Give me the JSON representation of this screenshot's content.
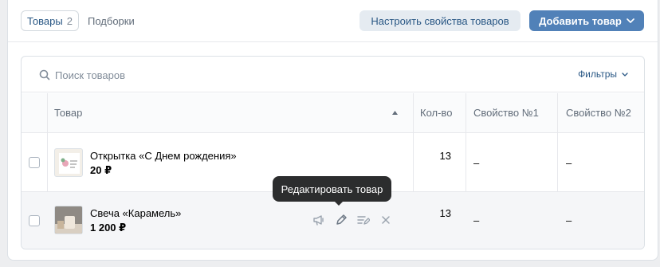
{
  "tabs": [
    {
      "label": "Товары",
      "count": "2"
    },
    {
      "label": "Подборки"
    }
  ],
  "toolbar": {
    "configure_label": "Настроить свойства товаров",
    "add_label": "Добавить товар"
  },
  "search": {
    "placeholder": "Поиск товаров",
    "value": ""
  },
  "filters_label": "Фильтры",
  "table": {
    "columns": [
      "Товар",
      "Кол-во",
      "Свойство №1",
      "Свойство №2"
    ],
    "rows": [
      {
        "name": "Открытка «С Днем рождения»",
        "price": "20 ₽",
        "qty": "13",
        "prop1": "–",
        "prop2": "–"
      },
      {
        "name": "Свеча «Карамель»",
        "price": "1 200 ₽",
        "qty": "13",
        "prop1": "–",
        "prop2": "–"
      }
    ]
  },
  "tooltip": "Редактировать товар",
  "icons": {
    "search": "search-icon",
    "chevron": "chevron-down-icon",
    "sort": "sort-arrow-icon",
    "promote": "megaphone-icon",
    "edit": "pencil-icon",
    "describe": "edit-lines-icon",
    "delete": "close-icon"
  },
  "colors": {
    "accent": "#5181b8",
    "link": "#2a5885",
    "muted": "#818c99",
    "tooltip_bg": "#2c2d2e"
  }
}
